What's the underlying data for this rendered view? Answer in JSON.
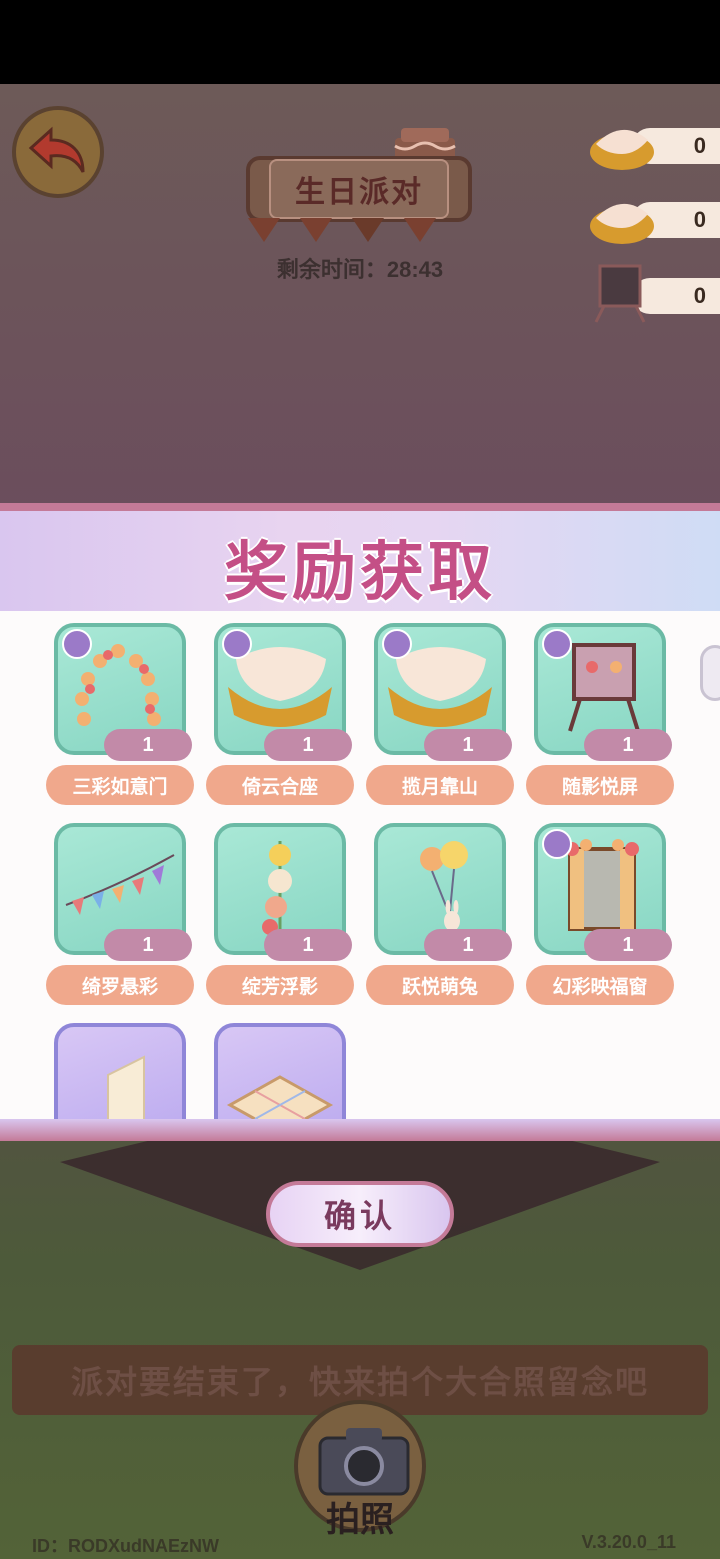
{
  "header": {
    "title": "生日派对",
    "timer": "剩余时间：28:43"
  },
  "resources": [
    {
      "icon": "cushion-icon",
      "count": "0"
    },
    {
      "icon": "cushion-icon",
      "count": "0"
    },
    {
      "icon": "easel-screen-icon",
      "count": "0"
    }
  ],
  "reward_panel": {
    "title": "奖励获取",
    "items": [
      {
        "name": "三彩如意门",
        "qty": "1",
        "icon": "balloon-arch-icon"
      },
      {
        "name": "倚云合座",
        "qty": "1",
        "icon": "cushion-seat-icon"
      },
      {
        "name": "揽月靠山",
        "qty": "1",
        "icon": "cushion-seat-icon"
      },
      {
        "name": "随影悦屏",
        "qty": "1",
        "icon": "easel-screen-icon"
      },
      {
        "name": "绮罗悬彩",
        "qty": "1",
        "icon": "bunting-icon"
      },
      {
        "name": "绽芳浮影",
        "qty": "1",
        "icon": "flower-garland-icon"
      },
      {
        "name": "跃悦萌兔",
        "qty": "1",
        "icon": "bunny-balloon-icon"
      },
      {
        "name": "幻彩映福窗",
        "qty": "1",
        "icon": "festive-window-icon"
      },
      {
        "name": "",
        "qty": "",
        "icon": "door-icon"
      },
      {
        "name": "",
        "qty": "",
        "icon": "floor-tile-icon"
      }
    ]
  },
  "confirm_label": "确认",
  "banner_text": "派对要结束了，快来拍个大合照留念吧",
  "camera_label": "拍照",
  "footer": {
    "id": "ID：RODXudNAEzNW",
    "version": "V.3.20.0_11"
  },
  "colors": {
    "panel_title": "#c44f86",
    "name_pill": "#f0a88c",
    "qty_pill": "#c28aa8",
    "card_green": "#a9e8d6",
    "card_purple": "#d8c7f5"
  }
}
